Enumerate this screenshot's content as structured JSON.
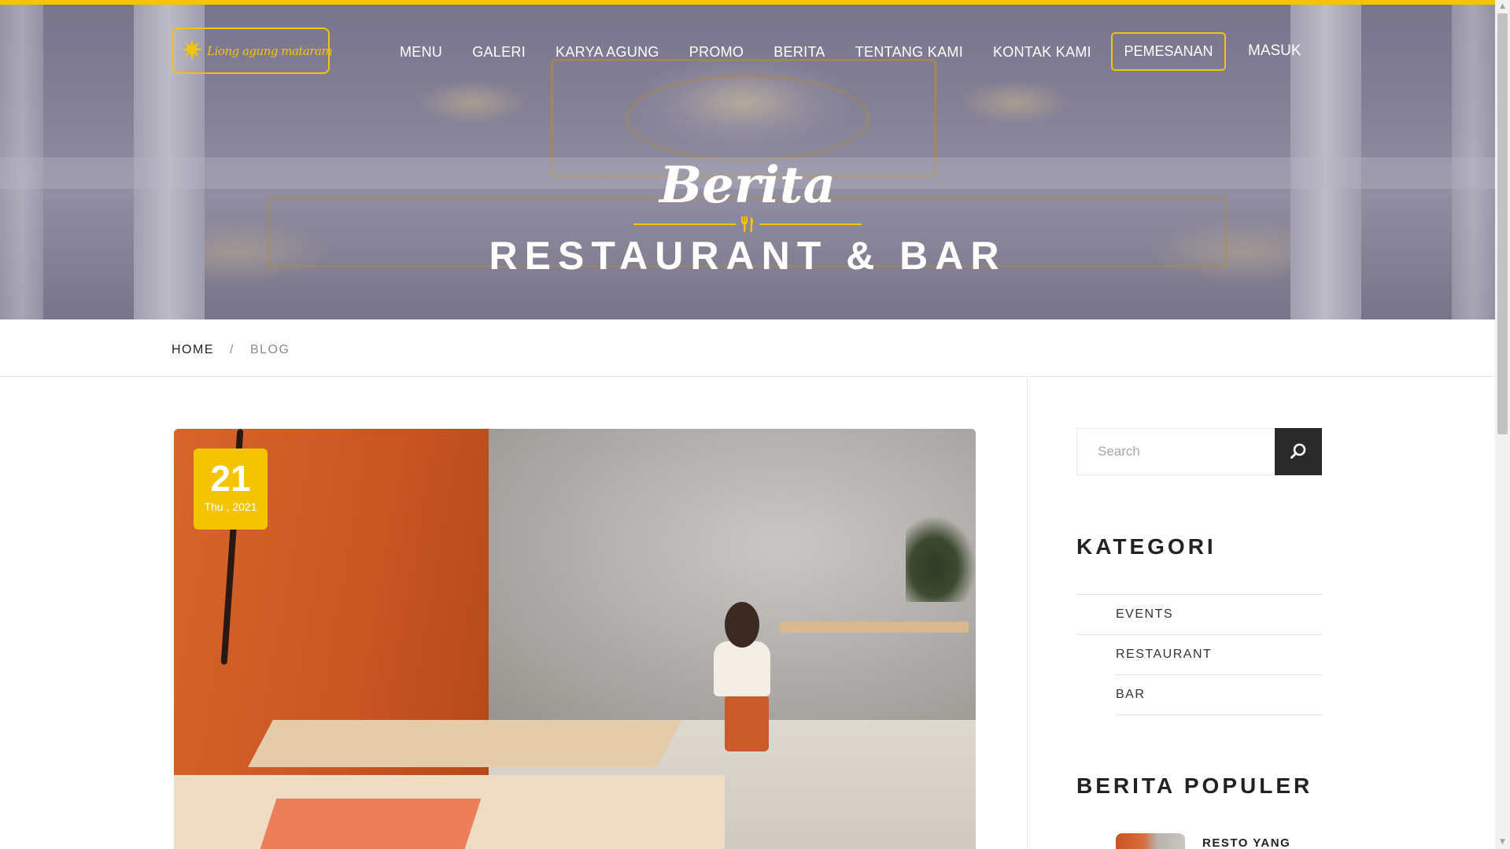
{
  "brand": {
    "logo_text": "Liong agung mataram",
    "accent_color": "#f5c400",
    "dark_color": "#2a2a2a"
  },
  "nav": {
    "items": [
      {
        "label": "MENU"
      },
      {
        "label": "GALERI"
      },
      {
        "label": "KARYA AGUNG"
      },
      {
        "label": "PROMO"
      },
      {
        "label": "BERITA"
      },
      {
        "label": "TENTANG KAMI"
      },
      {
        "label": "KONTAK KAMI"
      }
    ],
    "order_button": "PEMESANAN",
    "login": "MASUK"
  },
  "hero": {
    "script_title": "Berita",
    "divider_icon": "cutlery-icon",
    "subtitle": "RESTAURANT & BAR"
  },
  "breadcrumb": {
    "home": "HOME",
    "separator": "/",
    "current": "BLOG"
  },
  "post": {
    "date_day": "21",
    "date_meta": "Thu , 2021",
    "image_icon": "restaurant-photo"
  },
  "sidebar": {
    "search_placeholder": "Search",
    "search_icon": "search-icon",
    "category_title": "KATEGORI",
    "categories": [
      {
        "label": "EVENTS"
      },
      {
        "label": "RESTAURANT"
      },
      {
        "label": "BAR"
      }
    ],
    "popular_title": "BERITA POPULER",
    "popular_items": [
      {
        "title": "RESTO YANG"
      }
    ]
  }
}
